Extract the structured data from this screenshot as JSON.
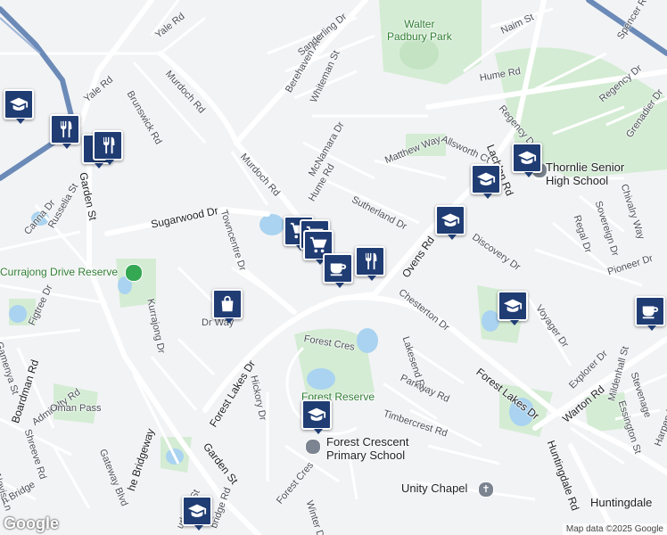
{
  "map": {
    "attribution": "Map data ©2025 Google",
    "logo": "Google",
    "labels": {
      "yale_rd_top": "Yale Rd",
      "yale_rd": "Yale Rd",
      "murdoch_rd": "Murdoch Rd",
      "murdoch_rd_2": "Murdoch Rd",
      "berehaven_ave": "Berehaven Ave",
      "sanderling_dr": "Sanderling Dr",
      "whiteman_st": "Whiteman St",
      "walter_padbury_park": "Walter\nPadbury Park",
      "hume_rd": "Hume Rd",
      "hume_rd_2": "Hume Rd",
      "naim_st": "Naim St",
      "spencer_rd": "Spencer Rd",
      "lachlan_rd": "Lachlan Rd",
      "regency_dr": "Regency Dr",
      "regency_dr_2": "Regency Dr",
      "allsworth_ct": "Allsworth Ct",
      "grenadier_dr": "Grenadier Dr",
      "brunswick_rd": "Brunswick Rd",
      "mcnamara_dr": "McNamara Dr",
      "matthew_way": "Matthew Way",
      "thornlie_shs": "Thornlie Senior\nHigh School",
      "garden_st": "Garden St",
      "sugarwood_dr": "Sugarwood Dr",
      "towncentre_dr": "Towncentre Dr",
      "sutherland_dr": "Sutherland Dr",
      "sovereign_dr": "Sovereign Dr",
      "chivalry_way": "Chivalry Way",
      "canna_dr": "Canna Dr",
      "russelia_st": "Russelia St",
      "regal_dr": "Regal Dr",
      "currajong_reserve": "Currajong Drive Reserve",
      "ovens_rd": "Ovens Rd",
      "discovery_dr": "Discovery Dr",
      "pioneer_dr": "Pioneer Dr",
      "figtree_dr": "Figtree Dr",
      "kurrajong_dr": "Kurrajong Dr",
      "chesterton_dr": "Chesterton Dr",
      "voyager_dr": "Voyager Dr",
      "forest_cres": "Forest Cres",
      "lakesend_rd": "Lakesend Rd",
      "forest_lakes_dr": "Forest Lakes Dr",
      "forest_lakes_dr_2": "Forest Lakes Dr",
      "explorer_dr": "Explorer Dr",
      "gamenya_st": "Gamenya St",
      "boardman_rd": "Boardman Rd",
      "admiralty_rd": "Admiralty Rd",
      "oman_pass": "Oman Pass",
      "hickory_dr": "Hickory Dr",
      "forest_reserve": "Forest Reserve",
      "parkway_rd": "Parkway Rd",
      "warton_rd": "Warton Rd",
      "mildenhall_st": "Mildenhall St",
      "stevenage": "Stevenage",
      "essington_st": "Essington St",
      "timbercrest_rd": "Timbercrest Rd",
      "shreeve_rd": "Shreeve Rd",
      "gateway_blvd": "Gateway Blvd",
      "forest_crescent_ps": "Forest Crescent\nPrimary School",
      "huntingdale_rd": "Huntingdale Rd",
      "harpenden": "Harpenden",
      "nevis_ln": "Nevis Ln",
      "h_bridge": "h Bridge",
      "the_bridgeway": "he Bridgeway",
      "forest_cres_2": "Forest Cres",
      "unity_chapel": "Unity Chapel",
      "huntingdale": "Huntingdale",
      "winter_dr": "Winter Dr",
      "bridge_rd": "bridge Rd",
      "urbank_st": "urbank St",
      "melwa": "Melwa Tce",
      "dr_way": "Dr Way"
    },
    "markers": [
      {
        "type": "school",
        "icon": "graduation-cap-icon"
      },
      {
        "type": "restaurant",
        "icon": "fork-knife-icon"
      },
      {
        "type": "restaurant",
        "icon": "fork-knife-icon"
      },
      {
        "type": "restaurant",
        "icon": "fork-knife-icon"
      },
      {
        "type": "school",
        "icon": "graduation-cap-icon"
      },
      {
        "type": "school",
        "icon": "graduation-cap-icon"
      },
      {
        "type": "school",
        "icon": "graduation-cap-icon"
      },
      {
        "type": "shopping",
        "icon": "shopping-cart-icon"
      },
      {
        "type": "shopping",
        "icon": "shopping-cart-icon"
      },
      {
        "type": "shopping",
        "icon": "shopping-cart-icon"
      },
      {
        "type": "restaurant",
        "icon": "fork-knife-icon"
      },
      {
        "type": "cafe",
        "icon": "coffee-cup-icon"
      },
      {
        "type": "shop",
        "icon": "shopping-bag-icon"
      },
      {
        "type": "school",
        "icon": "graduation-cap-icon"
      },
      {
        "type": "cafe",
        "icon": "coffee-cup-icon"
      },
      {
        "type": "school",
        "icon": "graduation-cap-icon"
      },
      {
        "type": "school",
        "icon": "graduation-cap-icon"
      }
    ],
    "colors": {
      "background": "#f2f3f5",
      "road": "#ffffff",
      "park": "#d4ecd4",
      "water": "#a9d3f0",
      "highway": "#6b8ab8",
      "marker": "#1f3c73"
    }
  }
}
